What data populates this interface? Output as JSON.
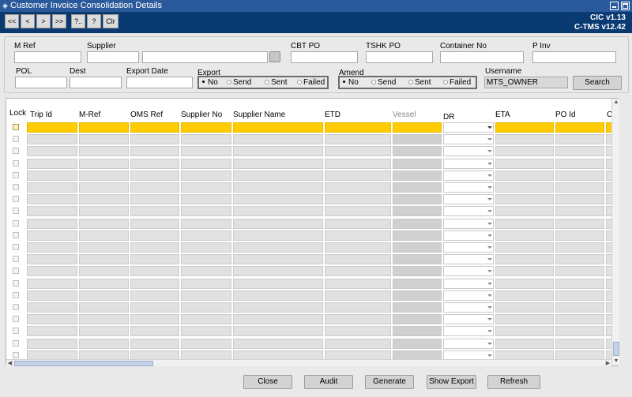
{
  "window": {
    "title": "Customer Invoice Consolidation Details"
  },
  "toolbar": {
    "nav": [
      "<<",
      "<",
      ">",
      ">>",
      "?..",
      "?",
      "Clr"
    ],
    "version1": "CIC v1.13",
    "version2": "C-TMS v12.42"
  },
  "form": {
    "mref_label": "M Ref",
    "supplier_label": "Supplier",
    "cbtpo_label": "CBT PO",
    "tshkpo_label": "TSHK PO",
    "container_label": "Container No",
    "pinv_label": "P Inv",
    "pol_label": "POL",
    "dest_label": "Dest",
    "export_date_label": "Export Date",
    "export_label": "Export",
    "export_options": [
      "No",
      "Send",
      "Sent",
      "Failed"
    ],
    "export_selected": "No",
    "amend_label": "Amend",
    "amend_options": [
      "No",
      "Send",
      "Sent",
      "Failed"
    ],
    "amend_selected": "No",
    "username_label": "Username",
    "username_value": "MTS_OWNER",
    "search_label": "Search"
  },
  "grid": {
    "columns": [
      "Lock",
      "Trip Id",
      "M-Ref",
      "OMS Ref",
      "Supplier No",
      "Supplier Name",
      "ETD",
      "Vessel",
      "DR",
      "ETA",
      "PO Id",
      "C"
    ]
  },
  "footer": {
    "close": "Close",
    "audit": "Audit",
    "generate": "Generate",
    "show_export": "Show Export",
    "refresh": "Refresh"
  },
  "colors": {
    "selected_row": "#ffcc00",
    "titlebar": "#2b5a9c",
    "toolbar": "#0a3a72"
  }
}
